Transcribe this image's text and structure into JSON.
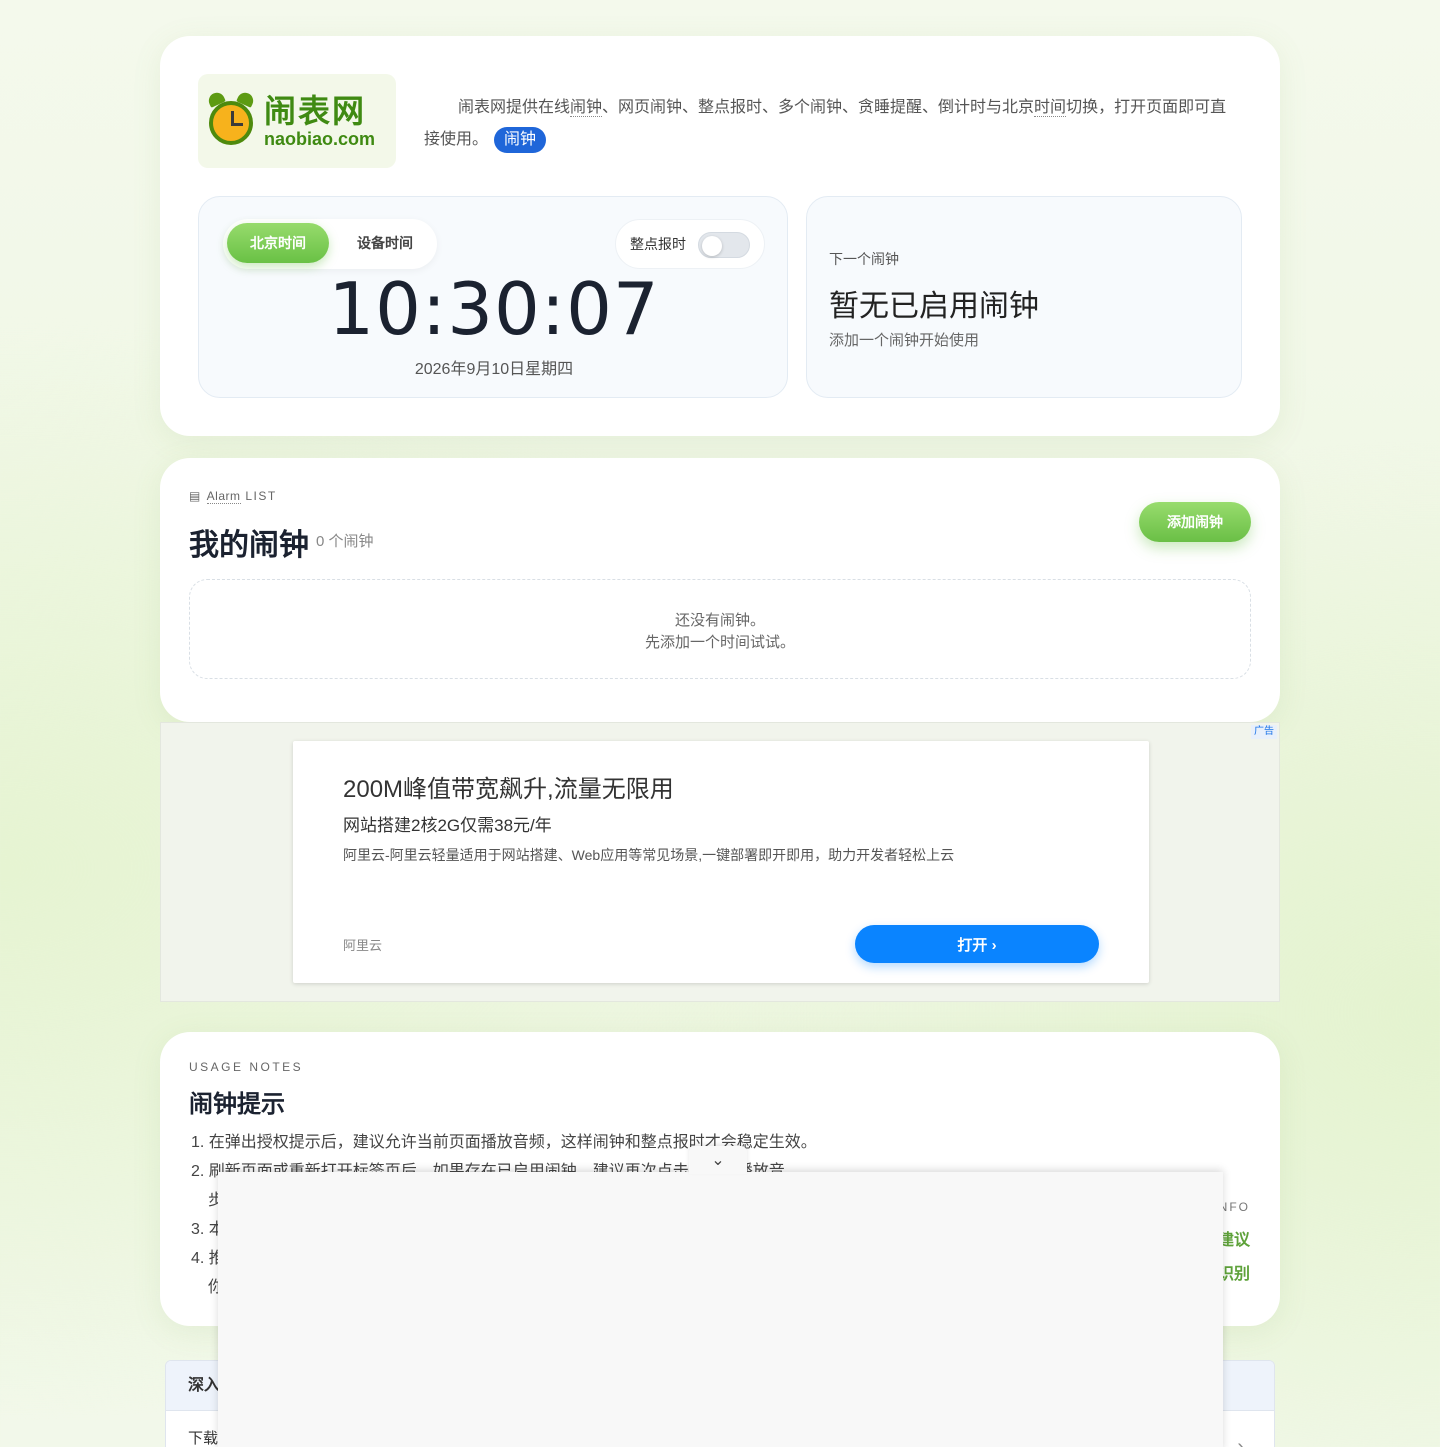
{
  "brand": {
    "logo_cn": "闹表网",
    "logo_en": "naobiao.com"
  },
  "intro": {
    "text_a": "闹表网提供在线",
    "word_clock": "闹钟",
    "text_b": "、网页闹钟、整点报时、多个闹钟、贪睡提醒、倒计时与北京",
    "word_time": "时间",
    "text_c": "切换，打开页面即可直接使用。",
    "badge": "闹钟"
  },
  "clock": {
    "tab_beijing": "北京时间",
    "tab_device": "设备时间",
    "chime_label": "整点报时",
    "chime_on": false,
    "time": "10:30:07",
    "date": "2026年9月10日星期四"
  },
  "next_alarm": {
    "label": "下一个闹钟",
    "title": "暂无已启用闹钟",
    "sub": "添加一个闹钟开始使用"
  },
  "alarm_list": {
    "eyebrow_word": "Alarm",
    "eyebrow_rest": " LIST",
    "title": "我的闹钟",
    "count": "0 个闹钟",
    "add_button": "添加闹钟",
    "empty_line1": "还没有闹钟。",
    "empty_line2": "先添加一个时间试试。"
  },
  "ad": {
    "tag": "广告",
    "headline": "200M峰值带宽飙升,流量无限用",
    "subhead": "网站搭建2核2G仅需38元/年",
    "desc": "阿里云-阿里云轻量适用于网站搭建、Web应用等常见场景,一键部署即开即用，助力开发者轻松上云",
    "brand": "阿里云",
    "cta": "打开 ›"
  },
  "notes": {
    "eyebrow": "USAGE NOTES",
    "title": "闹钟提示",
    "item1": "1. 在弹出授权提示后，建议允许当前页面播放音频，这样闹钟和整点报时才会稳定生效。",
    "item2": "2. 刷新页面或重新打开标签页后，如果存在已启用闹钟，建议再次点击",
    "item2_tail": "器播放音",
    "item2b": "步",
    "item3": "3. 本",
    "item4": "4. 推",
    "item4b": "你",
    "info_label": "NFO",
    "right_link1": "建议",
    "right_link2": "识别"
  },
  "faq": {
    "heading": "深入",
    "row1": "下载"
  },
  "overlay": {
    "toggle_icon": "chevron-down-icon",
    "glyph": "⌄"
  }
}
